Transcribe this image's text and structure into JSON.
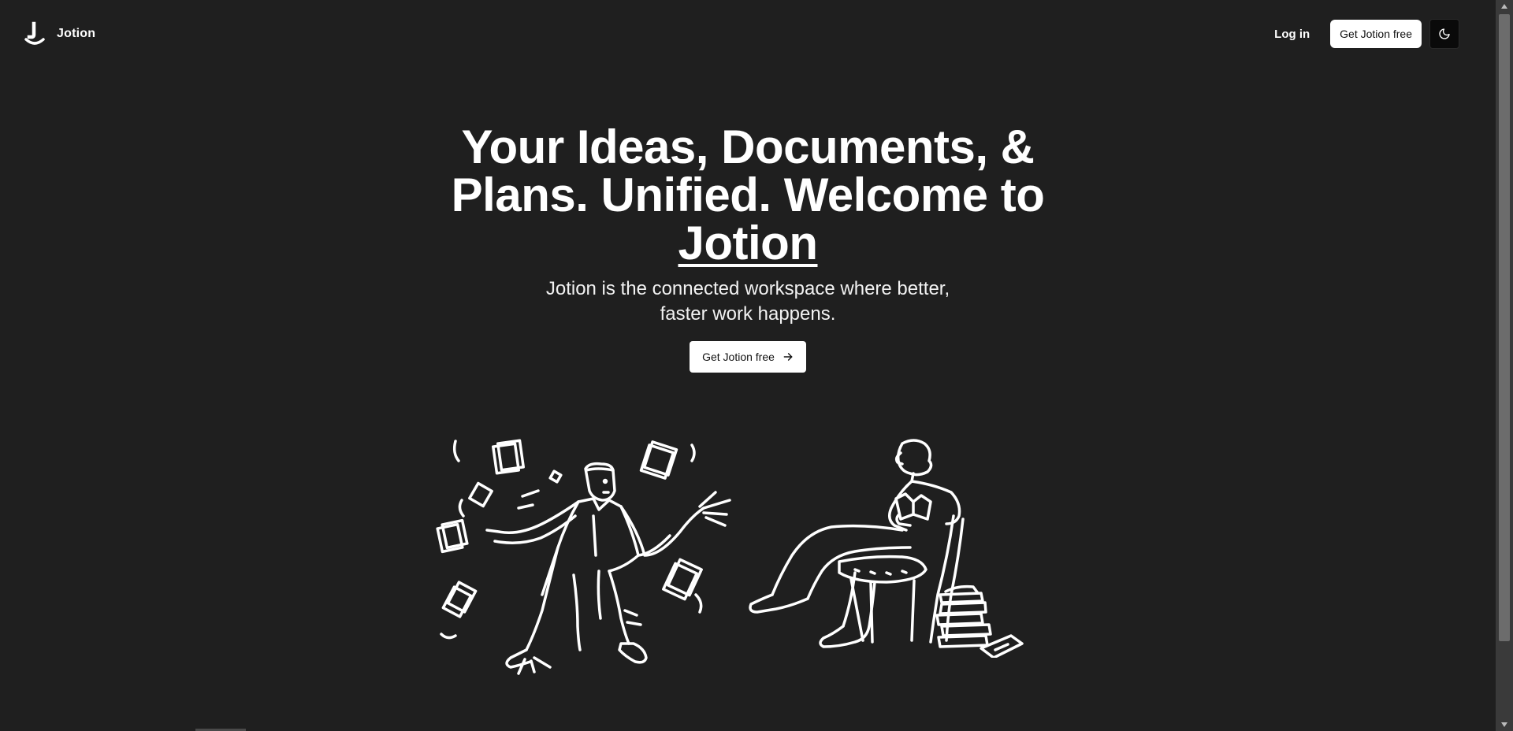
{
  "navbar": {
    "brand_name": "Jotion",
    "login_label": "Log in",
    "cta_label": "Get Jotion free",
    "theme_icon": "moon-icon"
  },
  "hero": {
    "title_line": "Your Ideas, Documents, & Plans. Unified. Welcome to",
    "title_brand": "Jotion",
    "subtitle": "Jotion is the connected workspace where better, faster work happens.",
    "cta_label": "Get Jotion free",
    "cta_icon": "arrow-right-icon"
  },
  "illustrations": {
    "left": "person-throwing-papers",
    "right": "person-reading-on-chair"
  },
  "colors": {
    "background": "#1f1f1f",
    "text": "#ffffff",
    "button_bg": "#ffffff",
    "button_text": "#111111",
    "theme_toggle_bg": "#0a0a0a"
  }
}
